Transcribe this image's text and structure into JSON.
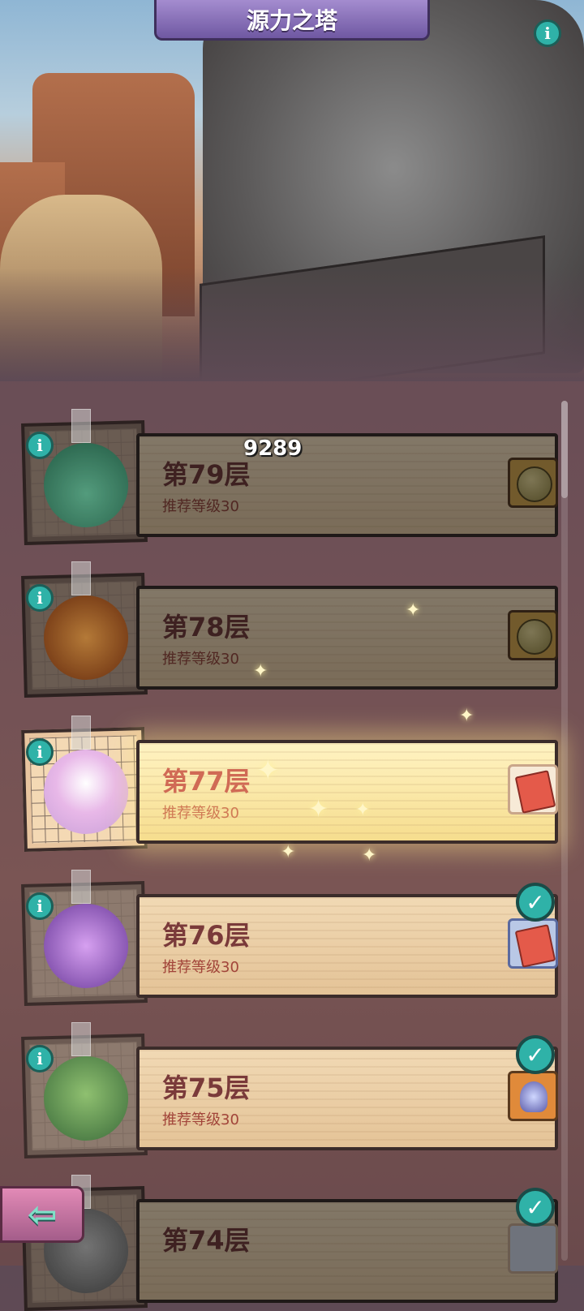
{
  "title": "源力之塔",
  "damage_popup": "9289",
  "floors": [
    {
      "floor": "第79层",
      "level": "推荐等级30",
      "reward": "coin",
      "cleared": false,
      "monster": "green-plant-monster"
    },
    {
      "floor": "第78层",
      "level": "推荐等级30",
      "reward": "coin",
      "cleared": false,
      "monster": "pumpkin-monster"
    },
    {
      "floor": "第77层",
      "level": "推荐等级30",
      "reward": "red-book",
      "cleared": false,
      "current": true,
      "monster": "eye-orb-monster"
    },
    {
      "floor": "第76层",
      "level": "推荐等级30",
      "reward": "red-book",
      "cleared": true,
      "monster": "purple-crab-monster"
    },
    {
      "floor": "第75层",
      "level": "推荐等级30",
      "reward": "crystal-item",
      "cleared": true,
      "monster": "goblin-monster"
    },
    {
      "floor": "第74层",
      "level": "",
      "reward": "clock-item",
      "cleared": true,
      "monster": "cat-monster"
    }
  ],
  "colors": {
    "accent": "#2fb2a8",
    "title_banner": "#8a72bf",
    "floor_text": "#7a3a3a",
    "level_text": "#a2453a"
  },
  "icons": {
    "info": "info-icon",
    "check": "check-icon",
    "back": "back-arrow-icon"
  }
}
